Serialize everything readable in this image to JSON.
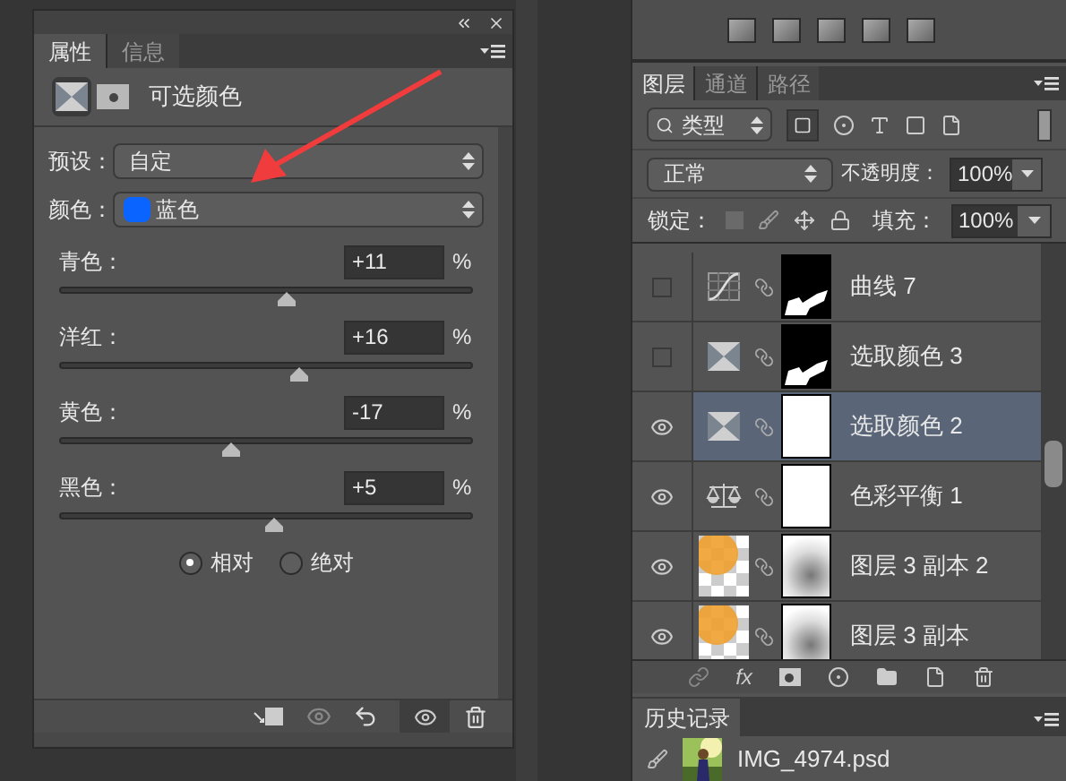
{
  "properties_panel": {
    "tabs": [
      {
        "label": "属性",
        "selected": true
      },
      {
        "label": "信息",
        "selected": false
      }
    ],
    "title": "可选颜色",
    "preset": {
      "label": "预设：",
      "value": "自定"
    },
    "colors": {
      "label": "颜色：",
      "value": "蓝色",
      "color": "#0a64ff"
    },
    "sliders": [
      {
        "label": "青色：",
        "value": "+11",
        "unit": "%",
        "level": 0.55
      },
      {
        "label": "洋红：",
        "value": "+16",
        "unit": "%",
        "level": 0.577
      },
      {
        "label": "黄色：",
        "value": "-17",
        "unit": "%",
        "level": 0.415
      },
      {
        "label": "黑色：",
        "value": "+5",
        "unit": "%",
        "level": 0.52
      }
    ],
    "modes": [
      {
        "label": "相对",
        "selected": true
      },
      {
        "label": "绝对",
        "selected": false
      }
    ]
  },
  "layers_panel": {
    "tabs": [
      {
        "label": "图层",
        "selected": true
      },
      {
        "label": "通道",
        "selected": false
      },
      {
        "label": "路径",
        "selected": false
      }
    ],
    "filter": "类型",
    "blend_mode": "正常",
    "opacity_label": "不透明度：",
    "opacity": "100%",
    "lock_label": "锁定：",
    "fill_label": "填充：",
    "fill": "100%",
    "layers": [
      {
        "name": "曲线 7",
        "visible": false,
        "selected": false,
        "kind": "curves",
        "mask": {
          "kind": "black"
        }
      },
      {
        "name": "选取颜色 3",
        "visible": false,
        "selected": false,
        "kind": "selective_color",
        "mask": {
          "kind": "black"
        }
      },
      {
        "name": "选取颜色 2",
        "visible": true,
        "selected": true,
        "kind": "selective_color",
        "mask": {
          "kind": "white"
        }
      },
      {
        "name": "色彩平衡 1",
        "visible": true,
        "selected": false,
        "kind": "color_balance",
        "mask": {
          "kind": "white"
        }
      },
      {
        "name": "图层 3 副本 2",
        "visible": true,
        "selected": false,
        "kind": "pixel",
        "mask": {
          "kind": "soft"
        }
      },
      {
        "name": "图层 3 副本",
        "visible": true,
        "selected": false,
        "kind": "pixel",
        "mask": {
          "kind": "soft"
        }
      }
    ],
    "fx_label": "fx"
  },
  "history_panel": {
    "tab": "历史记录",
    "snapshot": "IMG_4974.psd"
  }
}
